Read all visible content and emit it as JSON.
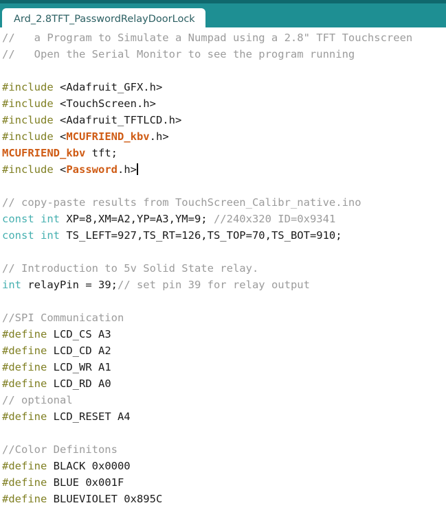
{
  "window": {
    "app": "Arduino IDE",
    "tab_bar_color": "#1e8f93",
    "tab_bar_top_strip_color": "#10686d",
    "editor_background": "#ffffff"
  },
  "tab": {
    "label": "Ard_2.8TFT_PasswordRelayDoorLock",
    "active": true,
    "text_color": "#2b5f62",
    "background": "#ffffff"
  },
  "syntax_colors": {
    "comment": "#9b9b9b",
    "preprocessor": "#7f7f22",
    "keyword": "#46b0b0",
    "library": "#cf5b14",
    "plain": "#1a1a1a"
  },
  "editor": {
    "caret_visible": true,
    "caret_line_index": 9,
    "lines": [
      {
        "i": 0,
        "segments": [
          {
            "c": "comment",
            "t": "//   a Program to Simulate a Numpad using a 2.8\" TFT Touchscreen"
          }
        ]
      },
      {
        "i": 1,
        "segments": [
          {
            "c": "comment",
            "t": "//   Open the Serial Monitor to see the program running"
          }
        ]
      },
      {
        "i": 2,
        "segments": [
          {
            "c": "plain",
            "t": ""
          }
        ]
      },
      {
        "i": 3,
        "segments": [
          {
            "c": "preproc",
            "t": "#include"
          },
          {
            "c": "plain",
            "t": " <Adafruit_GFX.h>"
          }
        ]
      },
      {
        "i": 4,
        "segments": [
          {
            "c": "preproc",
            "t": "#include"
          },
          {
            "c": "plain",
            "t": " <TouchScreen.h>"
          }
        ]
      },
      {
        "i": 5,
        "segments": [
          {
            "c": "preproc",
            "t": "#include"
          },
          {
            "c": "plain",
            "t": " <Adafruit_TFTLCD.h>"
          }
        ]
      },
      {
        "i": 6,
        "segments": [
          {
            "c": "preproc",
            "t": "#include"
          },
          {
            "c": "plain",
            "t": " <"
          },
          {
            "c": "lib",
            "t": "MCUFRIEND_kbv"
          },
          {
            "c": "plain",
            "t": ".h>"
          }
        ]
      },
      {
        "i": 7,
        "segments": [
          {
            "c": "lib",
            "t": "MCUFRIEND_kbv"
          },
          {
            "c": "plain",
            "t": " tft;"
          }
        ]
      },
      {
        "i": 8,
        "segments": [
          {
            "c": "preproc",
            "t": "#include"
          },
          {
            "c": "plain",
            "t": " <"
          },
          {
            "c": "lib",
            "t": "Password"
          },
          {
            "c": "plain",
            "t": ".h>"
          }
        ],
        "caret": true
      },
      {
        "i": 9,
        "segments": [
          {
            "c": "plain",
            "t": ""
          }
        ]
      },
      {
        "i": 10,
        "segments": [
          {
            "c": "comment",
            "t": "// copy-paste results from TouchScreen_Calibr_native.ino"
          }
        ]
      },
      {
        "i": 11,
        "segments": [
          {
            "c": "keyword",
            "t": "const int"
          },
          {
            "c": "plain",
            "t": " XP=8,XM=A2,YP=A3,YM=9; "
          },
          {
            "c": "comment",
            "t": "//240x320 ID=0x9341"
          }
        ]
      },
      {
        "i": 12,
        "segments": [
          {
            "c": "keyword",
            "t": "const int"
          },
          {
            "c": "plain",
            "t": " TS_LEFT=927,TS_RT=126,TS_TOP=70,TS_BOT=910;"
          }
        ]
      },
      {
        "i": 13,
        "segments": [
          {
            "c": "plain",
            "t": ""
          }
        ]
      },
      {
        "i": 14,
        "segments": [
          {
            "c": "comment",
            "t": "// Introduction to 5v Solid State relay."
          }
        ]
      },
      {
        "i": 15,
        "segments": [
          {
            "c": "keyword",
            "t": "int"
          },
          {
            "c": "plain",
            "t": " relayPin = 39;"
          },
          {
            "c": "comment",
            "t": "// set pin 39 for relay output"
          }
        ]
      },
      {
        "i": 16,
        "segments": [
          {
            "c": "plain",
            "t": ""
          }
        ]
      },
      {
        "i": 17,
        "segments": [
          {
            "c": "comment",
            "t": "//SPI Communication"
          }
        ]
      },
      {
        "i": 18,
        "segments": [
          {
            "c": "preproc",
            "t": "#define"
          },
          {
            "c": "plain",
            "t": " LCD_CS A3"
          }
        ]
      },
      {
        "i": 19,
        "segments": [
          {
            "c": "preproc",
            "t": "#define"
          },
          {
            "c": "plain",
            "t": " LCD_CD A2"
          }
        ]
      },
      {
        "i": 20,
        "segments": [
          {
            "c": "preproc",
            "t": "#define"
          },
          {
            "c": "plain",
            "t": " LCD_WR A1"
          }
        ]
      },
      {
        "i": 21,
        "segments": [
          {
            "c": "preproc",
            "t": "#define"
          },
          {
            "c": "plain",
            "t": " LCD_RD A0"
          }
        ]
      },
      {
        "i": 22,
        "segments": [
          {
            "c": "comment",
            "t": "// optional"
          }
        ]
      },
      {
        "i": 23,
        "segments": [
          {
            "c": "preproc",
            "t": "#define"
          },
          {
            "c": "plain",
            "t": " LCD_RESET A4"
          }
        ]
      },
      {
        "i": 24,
        "segments": [
          {
            "c": "plain",
            "t": ""
          }
        ]
      },
      {
        "i": 25,
        "segments": [
          {
            "c": "comment",
            "t": "//Color Definitons"
          }
        ]
      },
      {
        "i": 26,
        "segments": [
          {
            "c": "preproc",
            "t": "#define"
          },
          {
            "c": "plain",
            "t": " BLACK 0x0000"
          }
        ]
      },
      {
        "i": 27,
        "segments": [
          {
            "c": "preproc",
            "t": "#define"
          },
          {
            "c": "plain",
            "t": " BLUE 0x001F"
          }
        ]
      },
      {
        "i": 28,
        "segments": [
          {
            "c": "preproc",
            "t": "#define"
          },
          {
            "c": "plain",
            "t": " BLUEVIOLET 0x895C"
          }
        ]
      }
    ]
  }
}
